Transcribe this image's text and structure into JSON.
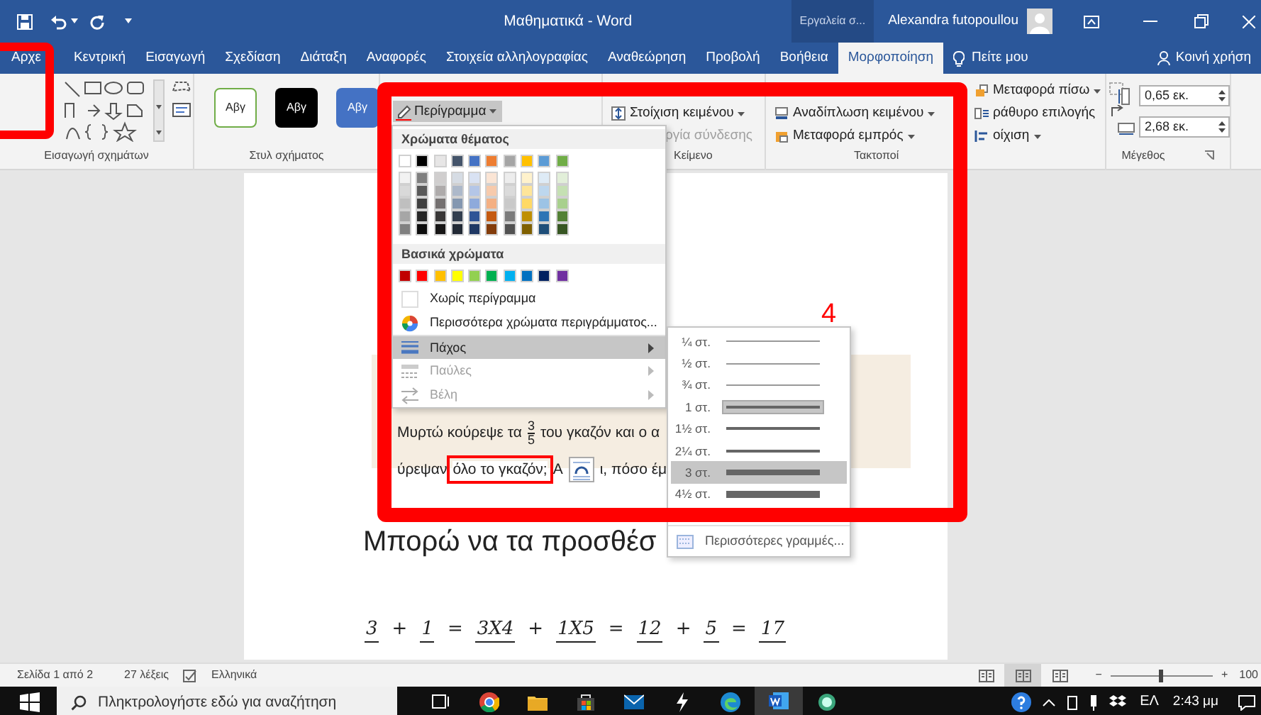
{
  "title_bar": {
    "title": "Μαθηματικά - Word",
    "context_tools": "Εργαλεία σ...",
    "user": "Alexandra futopoullou"
  },
  "tabs": [
    {
      "label": "Αρχε",
      "selected": false
    },
    {
      "label": "Κεντρική",
      "selected": false
    },
    {
      "label": "Εισαγωγή",
      "selected": false
    },
    {
      "label": "Σχεδίαση",
      "selected": false
    },
    {
      "label": "Διάταξη",
      "selected": false
    },
    {
      "label": "Αναφορές",
      "selected": false
    },
    {
      "label": "Στοιχεία αλληλογραφίας",
      "selected": false
    },
    {
      "label": "Αναθεώρηση",
      "selected": false
    },
    {
      "label": "Προβολή",
      "selected": false
    },
    {
      "label": "Βοήθεια",
      "selected": false
    },
    {
      "label": "Μορφοποίηση",
      "selected": true
    }
  ],
  "tell_me": "Πείτε μου",
  "share": "Κοινή χρήση",
  "ribbon": [
    {
      "kind": "shapes",
      "label": "Εισαγωγή σχημάτων"
    },
    {
      "kind": "styles",
      "label": "Στυλ σχήματος",
      "samples": [
        "Αβγ",
        "Αβγ",
        "Αβγ"
      ]
    },
    {
      "kind": "hidden"
    },
    {
      "kind": "text",
      "label": "Κείμενο",
      "items": [
        {
          "label": "Στοίχιση κειμένου",
          "disabled": false
        },
        {
          "label": "ργία σύνδεσης",
          "disabled": true
        }
      ]
    },
    {
      "kind": "arrange",
      "label": "Τακτοποί",
      "items": [
        {
          "label": "Αναδίπλωση κειμένου"
        },
        {
          "label": "Μεταφορά εμπρός"
        },
        {
          "label": "Μεταφορά πίσω"
        },
        {
          "label": "ράθυρο επιλογής"
        },
        {
          "label": "οίχιση"
        }
      ]
    },
    {
      "kind": "size",
      "label": "Μέγεθος",
      "fields": [
        "0,65 εκ.",
        "2,68 εκ."
      ]
    }
  ],
  "outline_button": "Περίγραμμα",
  "outline_menu": {
    "theme_header": "Χρώματα θέματος",
    "theme_colors": [
      {
        "shades": [
          {
            "color": "#ffffff"
          },
          {
            "color": "#f2f2f2"
          },
          {
            "color": "#d9d9d9"
          },
          {
            "color": "#bfbfbf"
          },
          {
            "color": "#a6a6a6"
          },
          {
            "color": "#808080"
          }
        ]
      },
      {
        "shades": [
          {
            "color": "#000000"
          },
          {
            "color": "#7f7f7f"
          },
          {
            "color": "#595959"
          },
          {
            "color": "#404040"
          },
          {
            "color": "#262626"
          },
          {
            "color": "#0d0d0d"
          }
        ]
      },
      {
        "shades": [
          {
            "color": "#e7e6e6"
          },
          {
            "color": "#d0cece"
          },
          {
            "color": "#aeabab"
          },
          {
            "color": "#757171"
          },
          {
            "color": "#3a3838"
          },
          {
            "color": "#171616"
          }
        ]
      },
      {
        "shades": [
          {
            "color": "#44546a"
          },
          {
            "color": "#d6dce4"
          },
          {
            "color": "#adb9ca"
          },
          {
            "color": "#8497b0"
          },
          {
            "color": "#333f4f"
          },
          {
            "color": "#222a35"
          }
        ]
      },
      {
        "shades": [
          {
            "color": "#4472c4"
          },
          {
            "color": "#d9e2f3"
          },
          {
            "color": "#b4c6e7"
          },
          {
            "color": "#8eaadb"
          },
          {
            "color": "#2f5496"
          },
          {
            "color": "#1f3864"
          }
        ]
      },
      {
        "shades": [
          {
            "color": "#ed7d31"
          },
          {
            "color": "#fbe5d5"
          },
          {
            "color": "#f7caac"
          },
          {
            "color": "#f4b083"
          },
          {
            "color": "#c55a11"
          },
          {
            "color": "#833c0b"
          }
        ]
      },
      {
        "shades": [
          {
            "color": "#a5a5a5"
          },
          {
            "color": "#ededed"
          },
          {
            "color": "#dbdbdb"
          },
          {
            "color": "#c9c9c9"
          },
          {
            "color": "#7b7b7b"
          },
          {
            "color": "#525252"
          }
        ]
      },
      {
        "shades": [
          {
            "color": "#ffc000"
          },
          {
            "color": "#fff2cc"
          },
          {
            "color": "#fee599"
          },
          {
            "color": "#ffd965"
          },
          {
            "color": "#bf8f00"
          },
          {
            "color": "#7f6000"
          }
        ]
      },
      {
        "shades": [
          {
            "color": "#5b9bd5"
          },
          {
            "color": "#deebf6"
          },
          {
            "color": "#bdd7ee"
          },
          {
            "color": "#9cc3e5"
          },
          {
            "color": "#2e75b5"
          },
          {
            "color": "#1e4e79"
          }
        ]
      },
      {
        "shades": [
          {
            "color": "#70ad47"
          },
          {
            "color": "#e2efd9"
          },
          {
            "color": "#c5e0b3"
          },
          {
            "color": "#a8d08d"
          },
          {
            "color": "#538135"
          },
          {
            "color": "#375623"
          }
        ]
      }
    ],
    "standard_header": "Βασικά χρώματα",
    "standard_colors": [
      {
        "color": "#c00000"
      },
      {
        "color": "#ff0000"
      },
      {
        "color": "#ffc000"
      },
      {
        "color": "#ffff00"
      },
      {
        "color": "#92d050"
      },
      {
        "color": "#00b050"
      },
      {
        "color": "#00b0f0"
      },
      {
        "color": "#0070c0"
      },
      {
        "color": "#002060"
      },
      {
        "color": "#7030a0"
      }
    ],
    "items": [
      {
        "kind": "none",
        "label": "Χωρίς περίγραμμα",
        "selected": false,
        "disabled": false,
        "submenu": false
      },
      {
        "kind": "palette",
        "label": "Περισσότερα χρώματα περιγράμματος...",
        "selected": false,
        "disabled": false,
        "submenu": false
      },
      {
        "kind": "weight",
        "label": "Πάχος",
        "selected": true,
        "disabled": false,
        "submenu": true
      },
      {
        "kind": "dashes",
        "label": "Παύλες",
        "selected": false,
        "disabled": true,
        "submenu": true
      },
      {
        "kind": "arrows",
        "label": "Βέλη",
        "selected": false,
        "disabled": true,
        "submenu": true
      }
    ]
  },
  "weight_menu": {
    "items": [
      {
        "label": "¼ στ.",
        "selected": false,
        "hovered": false
      },
      {
        "label": "½ στ.",
        "selected": false,
        "hovered": false
      },
      {
        "label": "¾ στ.",
        "selected": false,
        "hovered": false
      },
      {
        "label": "1 στ.",
        "selected": true,
        "hovered": false
      },
      {
        "label": "1½ στ.",
        "selected": false,
        "hovered": false
      },
      {
        "label": "2¼ στ.",
        "selected": false,
        "hovered": false
      },
      {
        "label": "3 στ.",
        "selected": false,
        "hovered": true
      },
      {
        "label": "4½ στ.",
        "selected": false,
        "hovered": false
      }
    ],
    "more": "Περισσότερες γραμμές..."
  },
  "document": {
    "lines": [
      [
        {
          "kind": "text",
          "text": "Μυρτώ κούρεψε τα"
        },
        {
          "kind": "fraction",
          "numerator": "3",
          "denominator": "5"
        },
        {
          "kind": "text",
          "text": "του γκαζόν και ο α"
        }
      ],
      [
        {
          "kind": "text",
          "text": "ύρεψαν"
        },
        {
          "kind": "text",
          "text": "όλο το γκαζόν;",
          "framed": true
        },
        {
          "kind": "text",
          "text": "Α"
        },
        {
          "kind": "layout_icon"
        },
        {
          "kind": "text",
          "text": "ι, πόσο έμ"
        }
      ]
    ],
    "heading": "Μπορώ να τα προσθέσ",
    "equation": [
      {
        "kind": "term",
        "text": "3"
      },
      {
        "kind": "op",
        "text": "+"
      },
      {
        "kind": "term",
        "text": "1"
      },
      {
        "kind": "op",
        "text": "="
      },
      {
        "kind": "term",
        "text": "3X4"
      },
      {
        "kind": "op",
        "text": "+"
      },
      {
        "kind": "term",
        "text": "1X5"
      },
      {
        "kind": "op",
        "text": "="
      },
      {
        "kind": "term",
        "text": "12"
      },
      {
        "kind": "op",
        "text": "+"
      },
      {
        "kind": "term",
        "text": "5"
      },
      {
        "kind": "op",
        "text": "="
      },
      {
        "kind": "term",
        "text": "17"
      }
    ]
  },
  "annotations": [
    {
      "kind": "frame",
      "label": "4"
    },
    {
      "kind": "frame"
    }
  ],
  "status_bar": {
    "page": "Σελίδα 1 από 2",
    "words": "27 λέξεις",
    "language": "Ελληνικά",
    "views": [
      {
        "selected": false
      },
      {
        "selected": true
      },
      {
        "selected": false
      }
    ],
    "zoom": {
      "out": "−",
      "level": 0.5,
      "in": "+",
      "reading": "100"
    }
  },
  "taskbar": {
    "search_placeholder": "Πληκτρολογήστε εδώ για αναζήτηση",
    "apps": [
      {
        "kind": "taskview",
        "selected": false
      },
      {
        "kind": "chrome",
        "selected": false
      },
      {
        "kind": "folder",
        "selected": false
      },
      {
        "kind": "store",
        "selected": false
      },
      {
        "kind": "mail",
        "selected": false
      },
      {
        "kind": "bolt",
        "selected": false
      },
      {
        "kind": "edge",
        "selected": false
      },
      {
        "kind": "word",
        "selected": true
      },
      {
        "kind": "circle",
        "selected": false
      }
    ],
    "language": "ΕΛ",
    "time": "2:43 μμ"
  }
}
